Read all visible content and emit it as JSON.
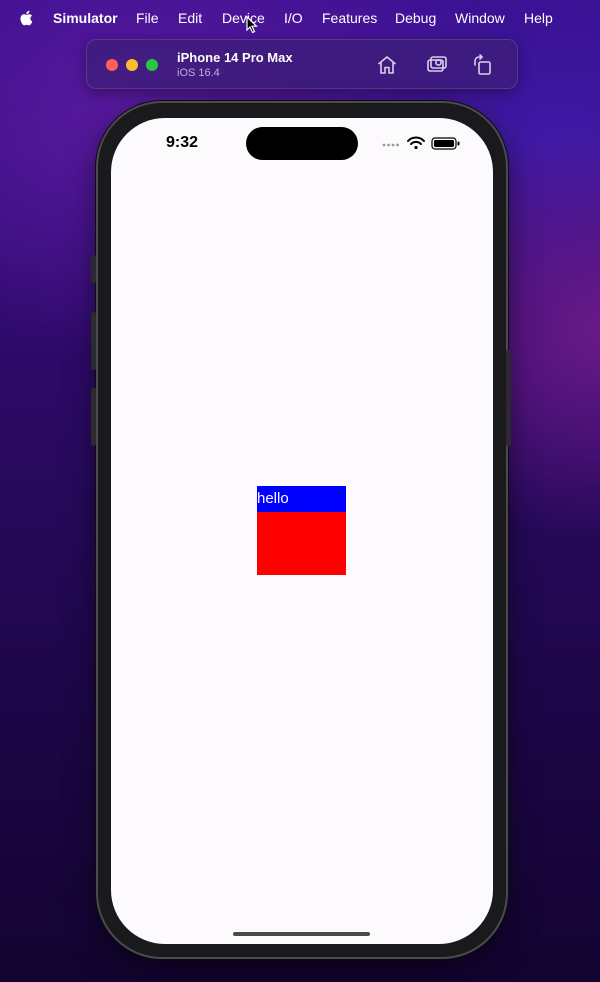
{
  "menubar": {
    "app_name": "Simulator",
    "items": [
      "File",
      "Edit",
      "Device",
      "I/O",
      "Features",
      "Debug",
      "Window",
      "Help"
    ]
  },
  "toolbar": {
    "device_name": "iPhone 14 Pro Max",
    "os_version": "iOS 16.4",
    "buttons": [
      "home-icon",
      "screenshot-icon",
      "rotate-icon"
    ]
  },
  "device": {
    "time": "9:32",
    "status_icons": [
      "signal-dots-icon",
      "wifi-icon",
      "battery-icon"
    ],
    "content_label": "hello"
  },
  "colors": {
    "screen_bg": "#fcfafc",
    "label_bg": "#0000ff",
    "box_bg": "#ff0000",
    "label_text": "#ffffff"
  }
}
